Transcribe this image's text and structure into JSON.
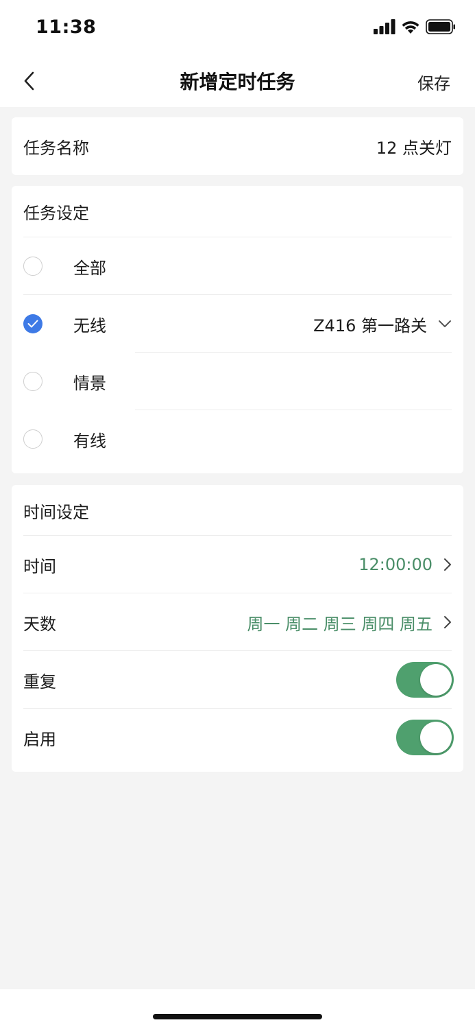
{
  "status_bar": {
    "time": "11:38"
  },
  "nav": {
    "title": "新增定时任务",
    "save_label": "保存"
  },
  "task_name": {
    "label": "任务名称",
    "value": "12 点关灯"
  },
  "task_settings": {
    "header": "任务设定",
    "options": [
      {
        "label": "全部",
        "checked": false
      },
      {
        "label": "无线",
        "checked": true,
        "selected_device": "Z416 第一路关"
      },
      {
        "label": "情景",
        "checked": false
      },
      {
        "label": "有线",
        "checked": false
      }
    ]
  },
  "time_settings": {
    "header": "时间设定",
    "time_label": "时间",
    "time_value": "12:00:00",
    "days_label": "天数",
    "days_value": "周一 周二 周三 周四 周五",
    "repeat_label": "重复",
    "repeat_on": true,
    "enable_label": "启用",
    "enable_on": true
  },
  "colors": {
    "accent_blue": "#3e7ae6",
    "accent_green": "#4fa06e",
    "value_green": "#4a8e68",
    "background": "#f4f4f4"
  }
}
